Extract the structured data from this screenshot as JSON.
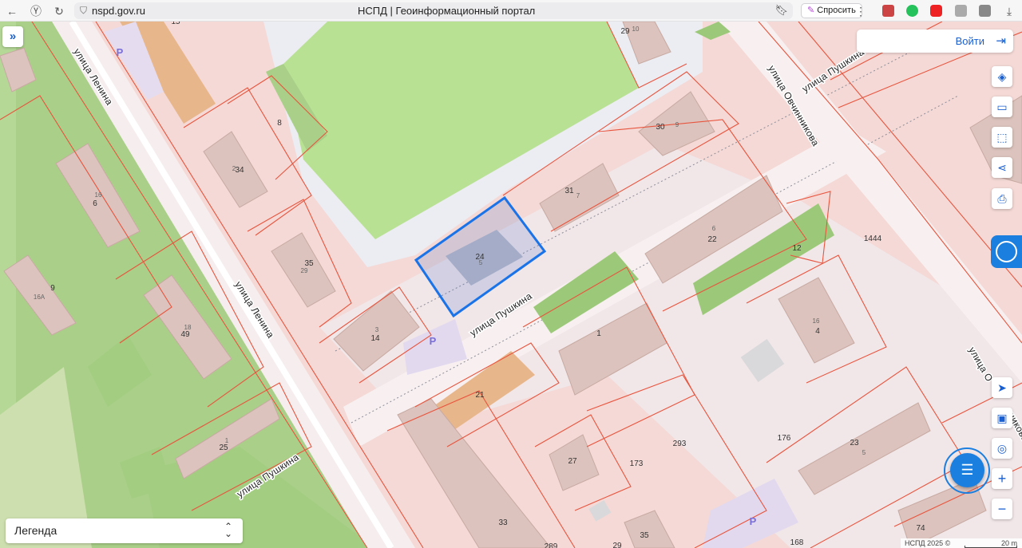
{
  "browser": {
    "url": "nspd.gov.ru",
    "tab_title": "НСПД | Геоинформационный портал",
    "ask_label": "Спросить"
  },
  "header": {
    "login_label": "Войти"
  },
  "legend": {
    "label": "Легенда"
  },
  "footer": {
    "copyright": "НСПД 2025 ©",
    "scale": "20 m"
  },
  "streets": {
    "lenina_1": "улица Ленина",
    "lenina_2": "улица Ленина",
    "pushkina_1": "улица Пушкина",
    "pushkina_2": "улица Пушкина",
    "pushkina_3": "улица Пушкина",
    "ovchinnikova": "улица Овчинникова",
    "ovchinnikova_2": "улица О",
    "ovchinnikova_3": "никова"
  },
  "parking_label": "P",
  "building_numbers": {
    "b15": "15",
    "b29": "29",
    "b10": "10",
    "b8": "8",
    "b34": "34",
    "b34s": "2",
    "b16_6a": "16",
    "b6": "6",
    "b30": "30",
    "b9s": "9",
    "b31": "31",
    "b7s": "7",
    "b35": "35",
    "b29s": "29",
    "b24": "24",
    "b5s": "5",
    "b6s": "6",
    "b22": "22",
    "b12": "12",
    "b1444": "1444",
    "b9": "9",
    "b16A": "16А",
    "b18s": "18",
    "b49": "49",
    "b3s": "3",
    "b14": "14",
    "b1": "1",
    "b16s": "16",
    "b4": "4",
    "b21": "21",
    "b293": "293",
    "b176": "176",
    "b23": "23",
    "b5s2": "5",
    "b1s": "1",
    "b25": "25",
    "b27": "27",
    "b173": "173",
    "b33": "33",
    "b35b": "35",
    "b29b": "29",
    "b289": "289",
    "b168": "168",
    "b74": "74"
  },
  "colors": {
    "parcel_fill": "#f4d9d6",
    "parcel_line": "#e8553e",
    "green_area": "#b8e092",
    "dark_green": "#95c173",
    "building": "#dcc3bd",
    "selected": "#1a73e8",
    "accent": "#1b7fe0"
  },
  "icons": {
    "layers": "layers-icon",
    "ruler": "ruler-icon",
    "select_area": "select-area-icon",
    "share": "share-icon",
    "print": "print-icon",
    "locate": "locate-icon",
    "map_switch": "map-switch-icon",
    "geo": "geo-icon",
    "zoom_in": "plus-icon",
    "zoom_out": "minus-icon",
    "chat": "chat-icon",
    "login": "login-icon",
    "expand": "expand-icon"
  }
}
